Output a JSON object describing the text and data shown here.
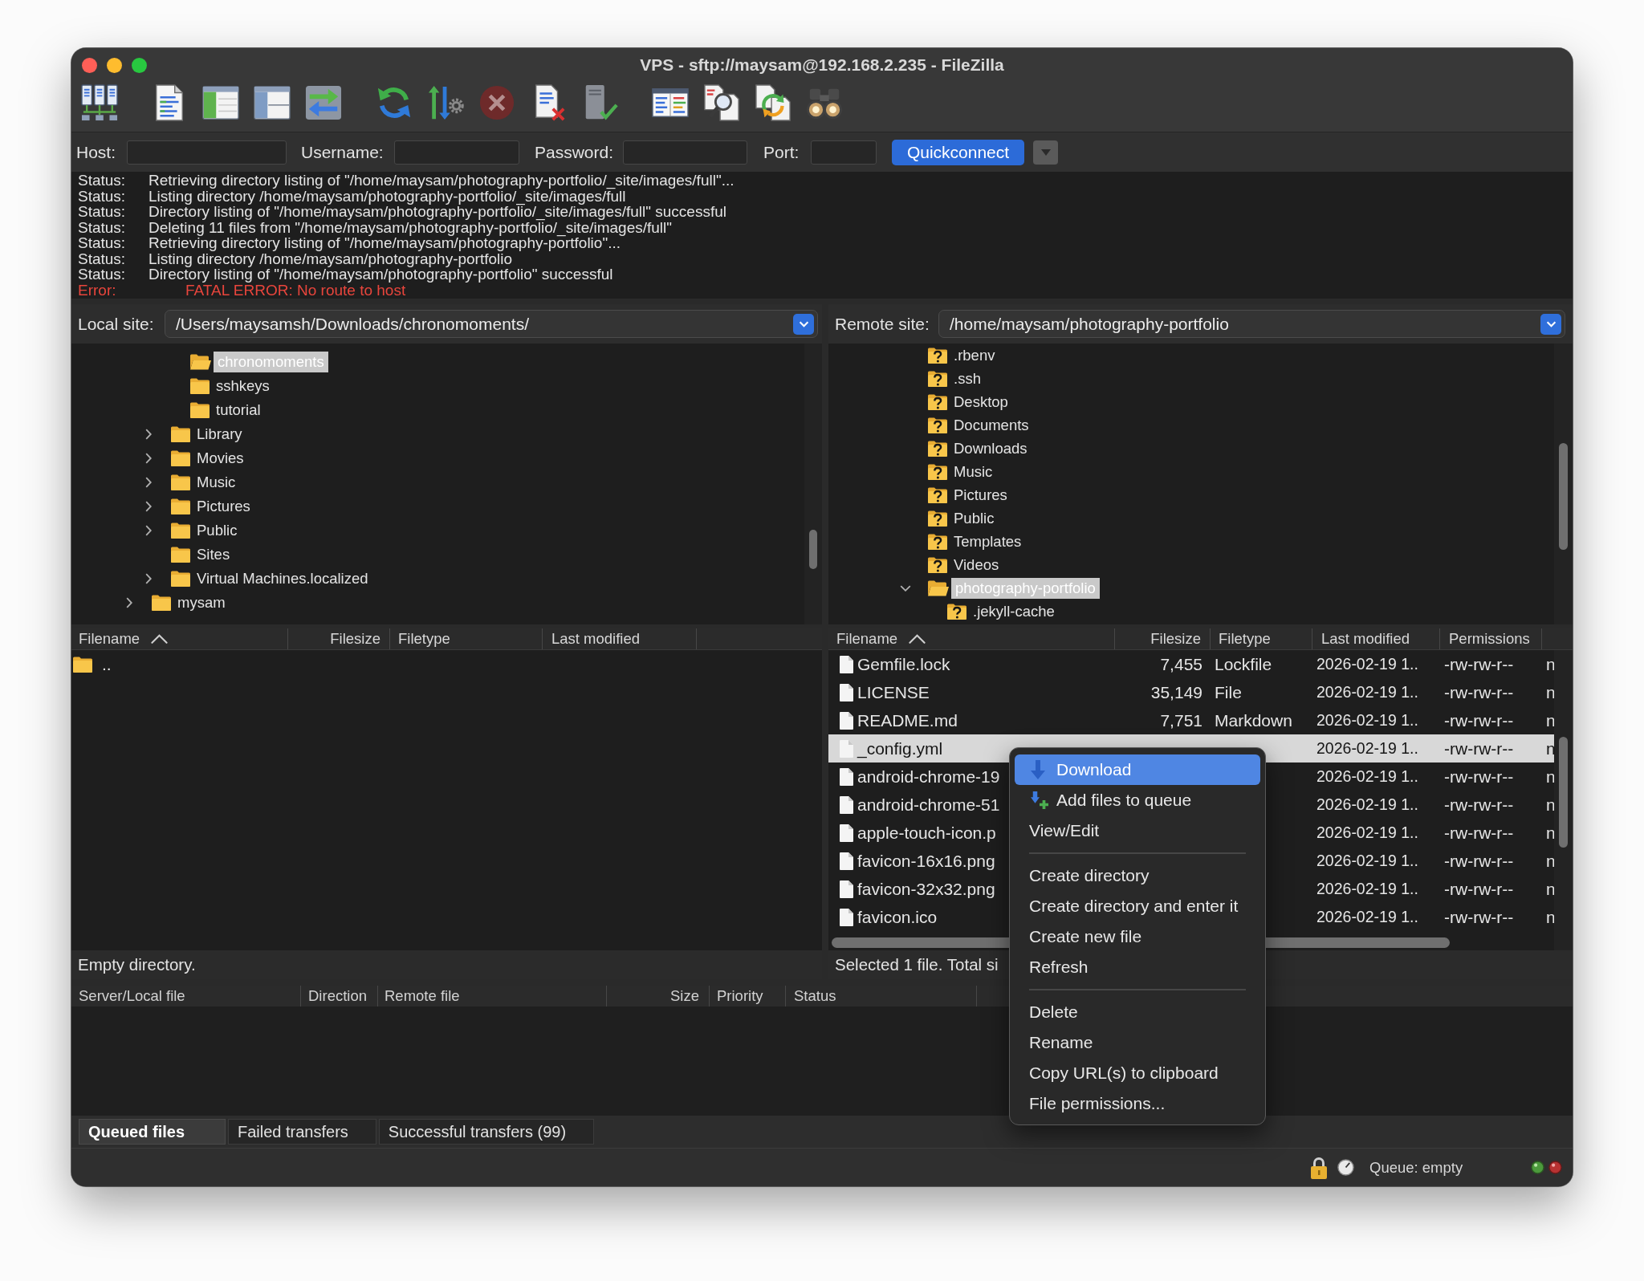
{
  "window": {
    "title": "VPS - sftp://maysam@192.168.2.235 - FileZilla"
  },
  "quickconnect": {
    "fields": [
      {
        "label": "Host:"
      },
      {
        "label": "Username:"
      },
      {
        "label": "Password:"
      },
      {
        "label": "Port:"
      }
    ],
    "button": "Quickconnect"
  },
  "message_log": [
    {
      "kind": "status",
      "label": "Status:",
      "message": "Retrieving directory listing of \"/home/maysam/photography-portfolio/_site/images/full\"..."
    },
    {
      "kind": "status",
      "label": "Status:",
      "message": "Listing directory /home/maysam/photography-portfolio/_site/images/full"
    },
    {
      "kind": "status",
      "label": "Status:",
      "message": "Directory listing of \"/home/maysam/photography-portfolio/_site/images/full\" successful"
    },
    {
      "kind": "status",
      "label": "Status:",
      "message": "Deleting 11 files from \"/home/maysam/photography-portfolio/_site/images/full\""
    },
    {
      "kind": "status",
      "label": "Status:",
      "message": "Retrieving directory listing of \"/home/maysam/photography-portfolio\"..."
    },
    {
      "kind": "status",
      "label": "Status:",
      "message": "Listing directory /home/maysam/photography-portfolio"
    },
    {
      "kind": "status",
      "label": "Status:",
      "message": "Directory listing of \"/home/maysam/photography-portfolio\" successful"
    },
    {
      "kind": "error",
      "label": "Error:",
      "message": "FATAL ERROR: No route to host"
    }
  ],
  "local": {
    "site_label": "Local site:",
    "path": "/Users/maysamsh/Downloads/chronomoments/",
    "tree": [
      {
        "children": [
          {
            "children": [
              {
                "label": "chronomoments",
                "kind": "open-folder",
                "selected": true
              },
              {
                "label": "sshkeys",
                "kind": "folder",
                "selected": false
              },
              {
                "label": "tutorial",
                "kind": "folder",
                "selected": false
              }
            ]
          },
          {
            "label": "Library",
            "kind": "folder",
            "selected": false,
            "expanded": false
          },
          {
            "label": "Movies",
            "kind": "folder",
            "selected": false,
            "expanded": false
          },
          {
            "label": "Music",
            "kind": "folder",
            "selected": false,
            "expanded": false
          },
          {
            "label": "Pictures",
            "kind": "folder",
            "selected": false,
            "expanded": false
          },
          {
            "label": "Public",
            "kind": "folder",
            "selected": false,
            "expanded": false
          },
          {
            "label": "Sites",
            "kind": "folder",
            "selected": false
          },
          {
            "label": "Virtual Machines.localized",
            "kind": "folder",
            "selected": false,
            "expanded": false
          }
        ]
      },
      {
        "label": "mysam",
        "kind": "folder",
        "selected": false,
        "expanded": false
      }
    ],
    "file_list": {
      "columns": [
        {
          "label": "Filename",
          "sorted": true
        },
        {
          "label": "Filesize",
          "sorted": false
        },
        {
          "label": "Filetype",
          "sorted": false
        },
        {
          "label": "Last modified",
          "sorted": false
        }
      ],
      "rows": [
        {
          "kind": "folder",
          "name": "..",
          "selected": false
        }
      ]
    },
    "status": "Empty directory."
  },
  "remote": {
    "site_label": "Remote site:",
    "path": "/home/maysam/photography-portfolio",
    "tree": [
      {
        "children": [
          {
            "label": ".rbenv",
            "kind": "unknown-folder",
            "selected": false
          },
          {
            "label": ".ssh",
            "kind": "unknown-folder",
            "selected": false
          },
          {
            "label": "Desktop",
            "kind": "unknown-folder",
            "selected": false
          },
          {
            "label": "Documents",
            "kind": "unknown-folder",
            "selected": false
          },
          {
            "label": "Downloads",
            "kind": "unknown-folder",
            "selected": false
          },
          {
            "label": "Music",
            "kind": "unknown-folder",
            "selected": false
          },
          {
            "label": "Pictures",
            "kind": "unknown-folder",
            "selected": false
          },
          {
            "label": "Public",
            "kind": "unknown-folder",
            "selected": false
          },
          {
            "label": "Templates",
            "kind": "unknown-folder",
            "selected": false
          },
          {
            "label": "Videos",
            "kind": "unknown-folder",
            "selected": false
          },
          {
            "label": "photography-portfolio",
            "kind": "open-folder",
            "selected": true,
            "expanded": true,
            "children": [
              {
                "label": ".jekyll-cache",
                "kind": "unknown-folder",
                "selected": false
              }
            ]
          }
        ]
      }
    ],
    "file_list": {
      "columns": [
        {
          "label": "Filename",
          "sorted": true
        },
        {
          "label": "Filesize",
          "sorted": false
        },
        {
          "label": "Filetype",
          "sorted": false
        },
        {
          "label": "Last modified",
          "sorted": false
        },
        {
          "label": "Permissions",
          "sorted": false
        }
      ],
      "rows": [
        {
          "kind": "file",
          "name": "Gemfile.lock",
          "filesize": "7,455",
          "filetype": "Lockfile",
          "last_modified": "2026-02-19 1..",
          "permissions": "-rw-rw-r--",
          "column_6": "n",
          "selected": false
        },
        {
          "kind": "file",
          "name": "LICENSE",
          "filesize": "35,149",
          "filetype": "File",
          "last_modified": "2026-02-19 1..",
          "permissions": "-rw-rw-r--",
          "column_6": "n",
          "selected": false
        },
        {
          "kind": "file",
          "name": "README.md",
          "filesize": "7,751",
          "filetype": "Markdown",
          "last_modified": "2026-02-19 1..",
          "permissions": "-rw-rw-r--",
          "column_6": "n",
          "selected": false
        },
        {
          "kind": "file",
          "name": "_config.yml",
          "last_modified": "2026-02-19 1..",
          "permissions": "-rw-rw-r--",
          "column_6": "n",
          "selected": true
        },
        {
          "kind": "file",
          "name": "android-chrome-19",
          "last_modified": "2026-02-19 1..",
          "permissions": "-rw-rw-r--",
          "column_6": "n",
          "selected": false
        },
        {
          "kind": "file",
          "name": "android-chrome-51",
          "last_modified": "2026-02-19 1..",
          "permissions": "-rw-rw-r--",
          "column_6": "n",
          "selected": false
        },
        {
          "kind": "file",
          "name": "apple-touch-icon.p",
          "last_modified": "2026-02-19 1..",
          "permissions": "-rw-rw-r--",
          "column_6": "n",
          "selected": false
        },
        {
          "kind": "file",
          "name": "favicon-16x16.png",
          "last_modified": "2026-02-19 1..",
          "permissions": "-rw-rw-r--",
          "column_6": "n",
          "selected": false
        },
        {
          "kind": "file",
          "name": "favicon-32x32.png",
          "last_modified": "2026-02-19 1..",
          "permissions": "-rw-rw-r--",
          "column_6": "n",
          "selected": false
        },
        {
          "kind": "file",
          "name": "favicon.ico",
          "last_modified": "2026-02-19 1..",
          "permissions": "-rw-rw-r--",
          "column_6": "n",
          "selected": false
        }
      ]
    },
    "status": "Selected 1 file. Total si"
  },
  "context_menu": {
    "items": [
      {
        "kind": "download",
        "label": "Download",
        "selected": true
      },
      {
        "kind": "enqueue",
        "label": "Add files to queue",
        "selected": false
      },
      {
        "kind": "item",
        "label": "View/Edit",
        "selected": false
      },
      {
        "kind": "separator"
      },
      {
        "kind": "item",
        "label": "Create directory",
        "selected": false
      },
      {
        "kind": "item",
        "label": "Create directory and enter it",
        "selected": false
      },
      {
        "kind": "item",
        "label": "Create new file",
        "selected": false
      },
      {
        "kind": "item",
        "label": "Refresh",
        "selected": false
      },
      {
        "kind": "separator"
      },
      {
        "kind": "item",
        "label": "Delete",
        "selected": false
      },
      {
        "kind": "item",
        "label": "Rename",
        "selected": false
      },
      {
        "kind": "item",
        "label": "Copy URL(s) to clipboard",
        "selected": false
      },
      {
        "kind": "item",
        "label": "File permissions...",
        "selected": false
      }
    ]
  },
  "queue": {
    "columns": [
      {
        "label": "Server/Local file"
      },
      {
        "label": "Direction"
      },
      {
        "label": "Remote file"
      },
      {
        "label": "Size"
      },
      {
        "label": "Priority"
      },
      {
        "label": "Status"
      }
    ],
    "tabs": [
      {
        "label": "Queued files",
        "selected": true
      },
      {
        "label": "Failed transfers",
        "selected": false
      },
      {
        "label": "Successful transfers (99)",
        "selected": false
      }
    ]
  },
  "status_bar": {
    "queue": "Queue: empty"
  }
}
